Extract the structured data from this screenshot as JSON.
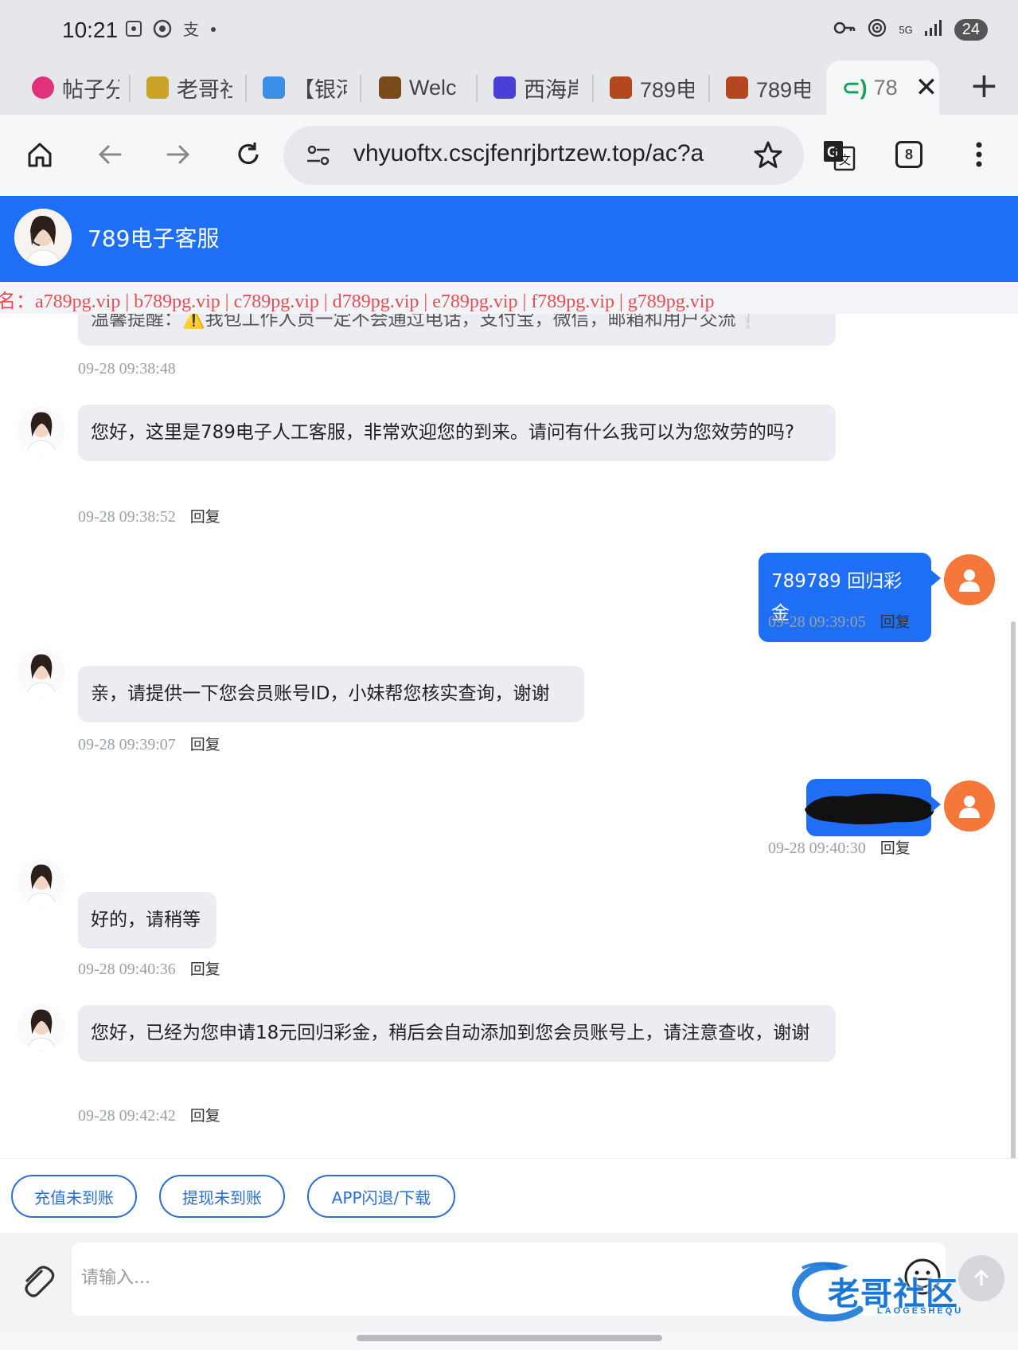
{
  "status_bar": {
    "time": "10:21",
    "network": "5G",
    "battery": "24"
  },
  "tabs": [
    {
      "label": "帖子分",
      "favicon_color": "#e0327b"
    },
    {
      "label": "老哥社",
      "favicon_color": "#c9a227"
    },
    {
      "label": "【银河",
      "favicon_color": "#3a8ee6"
    },
    {
      "label": "Welc",
      "favicon_color": "#7a4b1a"
    },
    {
      "label": "西海岸",
      "favicon_color": "#4a3fd6"
    },
    {
      "label": "789电",
      "favicon_color": "#b3471f"
    },
    {
      "label": "789电",
      "favicon_color": "#b3471f"
    }
  ],
  "active_tab": {
    "label": "78",
    "close": "✕"
  },
  "new_tab": "+",
  "toolbar": {
    "url": "vhyuoftx.cscjfenrjbrtzew.top/ac?a",
    "tab_count": "8"
  },
  "header": {
    "title": "789电子客服"
  },
  "marquee": {
    "text": "名：a789pg.vip | b789pg.vip | c789pg.vip | d789pg.vip | e789pg.vip | f789pg.vip | g789pg.vip"
  },
  "chat": {
    "reply_label": "回复",
    "messages": [
      {
        "from": "agent",
        "text": "温馨提醒：⚠️我包工作人员一定不会通过电话，支付宝，微信，邮箱和用户交流❕",
        "time": "09-28 09:38:48"
      },
      {
        "from": "agent",
        "text": "您好，这里是789电子人工客服，非常欢迎您的到来。请问有什么我可以为您效劳的吗?",
        "time": "09-28 09:38:52"
      },
      {
        "from": "user",
        "text": "789789 回归彩金",
        "time": "09-28 09:39:05"
      },
      {
        "from": "agent",
        "text": "亲，请提供一下您会员账号ID，小妹帮您核实查询，谢谢",
        "time": "09-28 09:39:07"
      },
      {
        "from": "user",
        "text": "",
        "time": "09-28 09:40:30"
      },
      {
        "from": "agent",
        "text": "好的，请稍等",
        "time": "09-28 09:40:36"
      },
      {
        "from": "agent",
        "text": "您好，已经为您申请18元回归彩金，稍后会自动添加到您会员账号上，请注意查收，谢谢",
        "time": "09-28 09:42:42"
      }
    ]
  },
  "quick_buttons": [
    "充值未到账",
    "提现未到账",
    "APP闪退/下载"
  ],
  "input": {
    "placeholder": "请输入..."
  },
  "watermark": {
    "text": "老哥社区",
    "subtext": "LAOGESHEQU"
  },
  "colors": {
    "accent": "#1e6ff5",
    "user_avatar": "#f5783a",
    "marquee": "#e94a55"
  }
}
